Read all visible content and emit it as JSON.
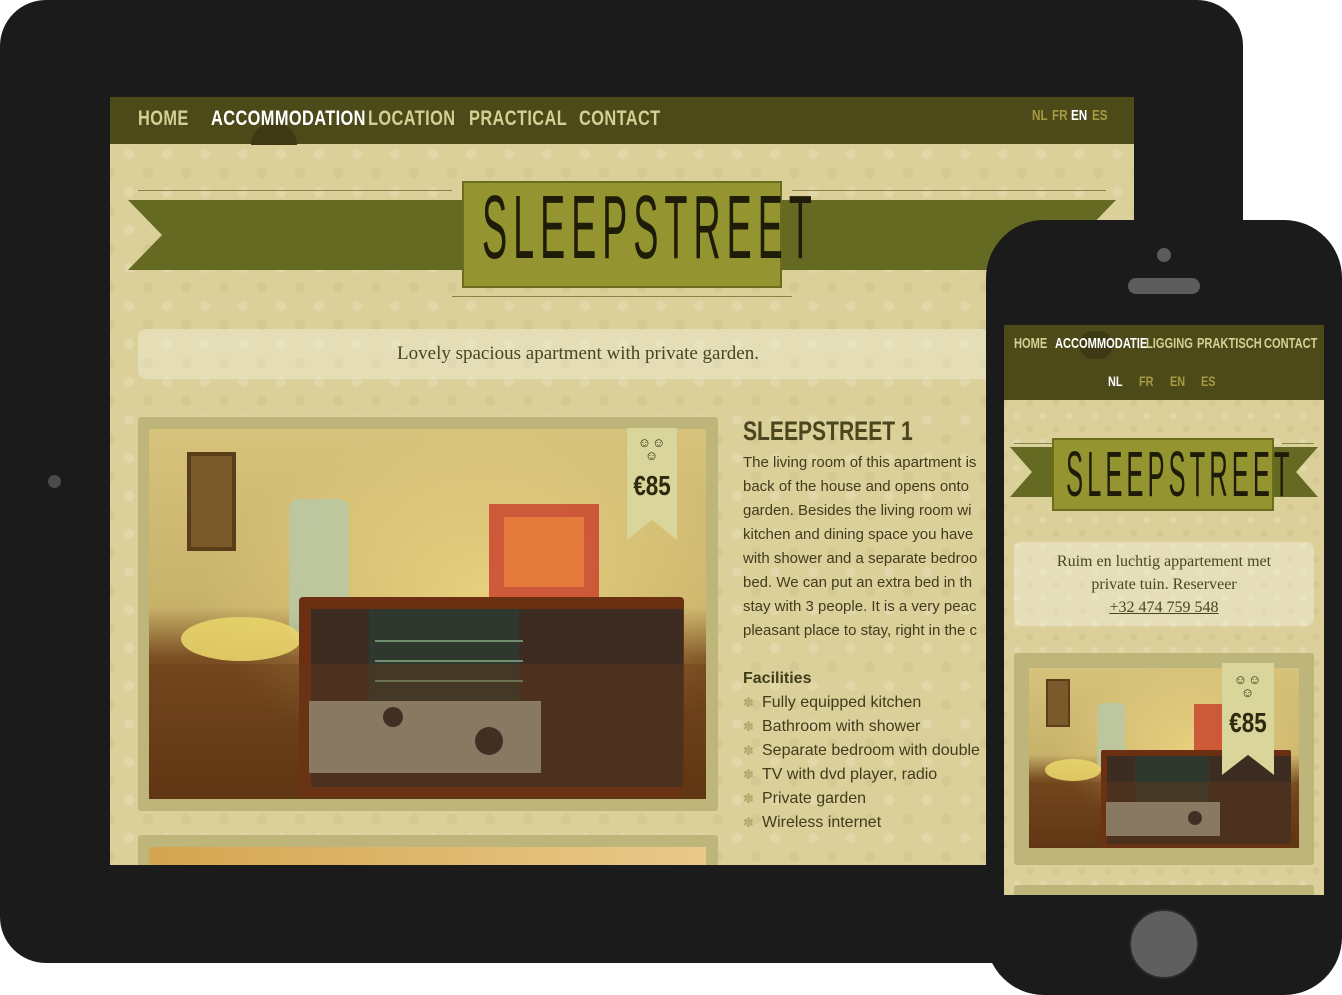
{
  "tablet": {
    "nav": {
      "items": [
        {
          "label": "HOME",
          "active": false
        },
        {
          "label": "ACCOMMODATION",
          "active": true
        },
        {
          "label": "LOCATION",
          "active": false
        },
        {
          "label": "PRACTICAL",
          "active": false
        },
        {
          "label": "CONTACT",
          "active": false
        }
      ],
      "languages": [
        {
          "label": "NL",
          "active": false
        },
        {
          "label": "FR",
          "active": false
        },
        {
          "label": "EN",
          "active": true
        },
        {
          "label": "ES",
          "active": false
        }
      ]
    },
    "logo": "SLEEPSTREET",
    "tagline": "Lovely spacious apartment with private garden.",
    "room": {
      "title": "SLEEPSTREET 1",
      "price": "€85",
      "description_lines": [
        "The living room of this apartment is",
        "back of the house and opens onto",
        "garden. Besides the living room wi",
        "kitchen and dining space you have",
        "with shower and a separate bedroo",
        "bed. We can put an extra bed in th",
        "stay with 3 people. It is a very peac",
        "pleasant place to stay, right in the c"
      ],
      "facilities_heading": "Facilities",
      "facilities": [
        "Fully equipped kitchen",
        "Bathroom with shower",
        "Separate bedroom with double",
        "TV with dvd player, radio",
        "Private garden",
        "Wireless internet"
      ]
    }
  },
  "phone": {
    "nav": {
      "items": [
        {
          "label": "HOME",
          "active": false
        },
        {
          "label": "ACCOMMODATIE",
          "active": true
        },
        {
          "label": "LIGGING",
          "active": false
        },
        {
          "label": "PRAKTISCH",
          "active": false
        },
        {
          "label": "CONTACT",
          "active": false
        }
      ],
      "languages": [
        {
          "label": "NL",
          "active": true
        },
        {
          "label": "FR",
          "active": false
        },
        {
          "label": "EN",
          "active": false
        },
        {
          "label": "ES",
          "active": false
        }
      ]
    },
    "logo": "SLEEPSTREET",
    "tagline_line1": "Ruim en luchtig appartement met",
    "tagline_line2": "private tuin. Reserveer",
    "tagline_phone": "+32 474 759 548",
    "price": "€85"
  },
  "colors": {
    "nav_bg": "#4d4a1a",
    "page_bg": "#dcd09a",
    "ribbon": "#646a22",
    "logo_box": "#949530",
    "device_body": "#1b1b1b"
  }
}
